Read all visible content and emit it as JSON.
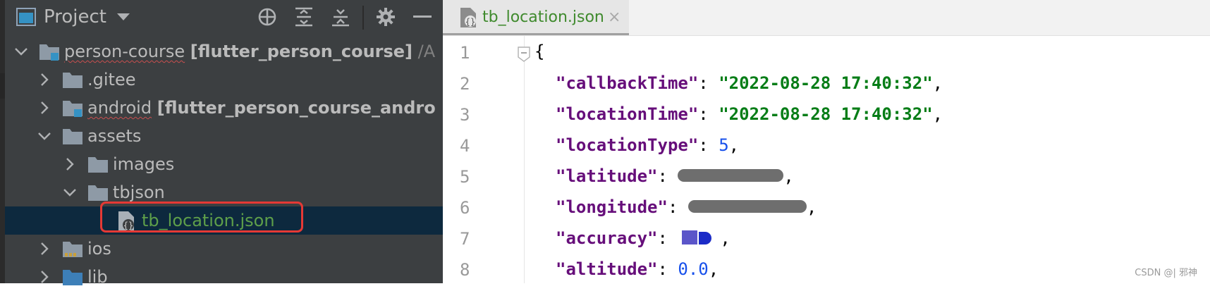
{
  "project_panel": {
    "title": "Project",
    "tree": [
      {
        "label": "person-course",
        "module": "[flutter_person_course]",
        "path": "/A"
      },
      {
        "label": ".gitee"
      },
      {
        "label": "android",
        "module": "[flutter_person_course_andro"
      },
      {
        "label": "assets"
      },
      {
        "label": "images"
      },
      {
        "label": "tbjson"
      },
      {
        "label": "tb_location.json"
      },
      {
        "label": "ios"
      },
      {
        "label": "lib"
      }
    ]
  },
  "editor": {
    "tab": {
      "title": "tb_location.json",
      "close": "×"
    },
    "line_numbers": [
      "1",
      "2",
      "3",
      "4",
      "5",
      "6",
      "7",
      "8"
    ],
    "code": {
      "open": "{",
      "l2": {
        "key": "\"callbackTime\"",
        "sep": ": ",
        "value": "\"2022-08-28 17:40:32\"",
        "end": ","
      },
      "l3": {
        "key": "\"locationTime\"",
        "sep": ": ",
        "value": "\"2022-08-28 17:40:32\"",
        "end": ","
      },
      "l4": {
        "key": "\"locationType\"",
        "sep": ": ",
        "value": "5",
        "end": ","
      },
      "l5": {
        "key": "\"latitude\"",
        "sep": ": ",
        "end": ","
      },
      "l6": {
        "key": "\"longitude\"",
        "sep": ": ",
        "end": ","
      },
      "l7": {
        "key": "\"accuracy\"",
        "sep": ": ",
        "end": ","
      },
      "l8": {
        "key": "\"altitude\"",
        "sep": ": ",
        "value": "0.0",
        "end": ","
      }
    }
  },
  "watermark": "CSDN @| 邪神",
  "colors": {
    "panel_bg": "#3c3f41",
    "selection_bg": "#0d293e",
    "highlight_box": "#e53935",
    "json_key": "#660e7a",
    "json_string": "#067d17",
    "json_number": "#1750eb"
  },
  "icons": [
    "project-icon",
    "dropdown-icon",
    "locate-icon",
    "expand-all-icon",
    "collapse-all-icon",
    "gear-icon",
    "minimize-icon",
    "folder-icon",
    "module-icon",
    "json-file-icon",
    "close-icon",
    "fold-icon"
  ]
}
